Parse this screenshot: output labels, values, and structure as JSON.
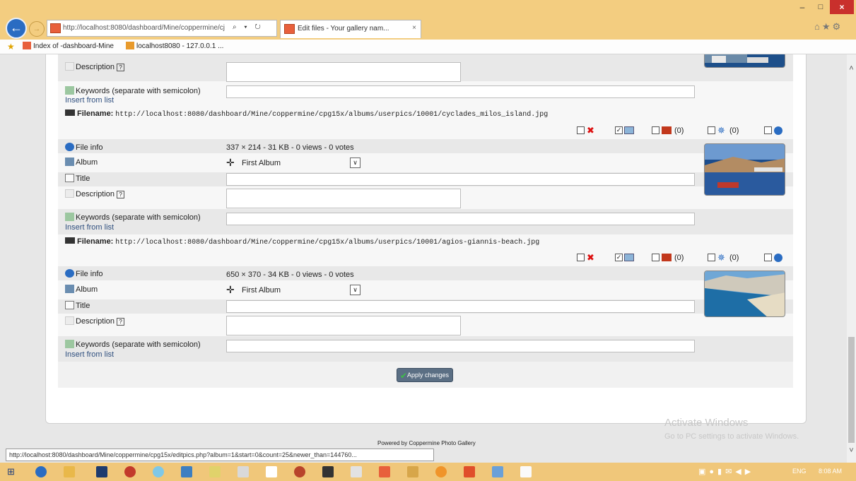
{
  "browser": {
    "address_url": "http://localhost:8080/dashboard/Mine/coppermine/cj",
    "address_tools": "⌕ ▾ ↻",
    "tab_title": "Edit files - Your gallery nam...",
    "tab_close": "×",
    "back_glyph": "←",
    "forward_glyph": "→",
    "window_min": "–",
    "window_max": "□",
    "window_close": "×",
    "top_icons": "⌂★⚙"
  },
  "favorites": {
    "star_glyph": "★",
    "items": [
      "Index of -dashboard-Mine",
      "localhost8080 - 127.0.0.1 ..."
    ]
  },
  "labels": {
    "description": "Description",
    "description_help": "?",
    "keywords": "Keywords (separate with semicolon)",
    "insert_from_list": "Insert from list",
    "filename": "Filename:",
    "file_info": "File info",
    "album": "Album",
    "title": "Title"
  },
  "files": [
    {
      "path": "http://localhost:8080/dashboard/Mine/coppermine/cpg15x/albums/userpics/10001/cyclades_milos_island.jpg",
      "info": "337 × 214 - 31 KB - 0 views - 0 votes",
      "album": "First Album",
      "rating_count": "(0)",
      "ecard_count": "(0)"
    },
    {
      "path": "http://localhost:8080/dashboard/Mine/coppermine/cpg15x/albums/userpics/10001/agios-giannis-beach.jpg",
      "info": "650 × 370 - 34 KB - 0 views - 0 votes",
      "album": "First Album",
      "rating_count": "(0)",
      "ecard_count": "(0)"
    }
  ],
  "icons": {
    "delete": "✖",
    "move": "✛",
    "select_arrow": "∨",
    "checked": "✓",
    "apply_check": "✔",
    "ecard": "✵",
    "scroll_up": "˄",
    "scroll_down": "˅",
    "start": "⊞"
  },
  "apply_button": "Apply changes",
  "powered_by": "Powered by Coppermine Photo Gallery",
  "watermark": {
    "title": "Activate Windows",
    "subtitle": "Go to PC settings to activate Windows."
  },
  "status_url": "http://localhost:8080/dashboard/Mine/coppermine/cpg15x/editpics.php?album=1&start=0&count=25&newer_than=144760...",
  "taskbar": {
    "tray_icons": "▣●▮✉◀▶",
    "language": "ENG",
    "time": "8:08 AM"
  },
  "colors": {
    "chrome": "#f3cd80",
    "taskbar": "#f0c77a",
    "link": "#2f4f7f",
    "apply_button": "#5b6f84"
  }
}
